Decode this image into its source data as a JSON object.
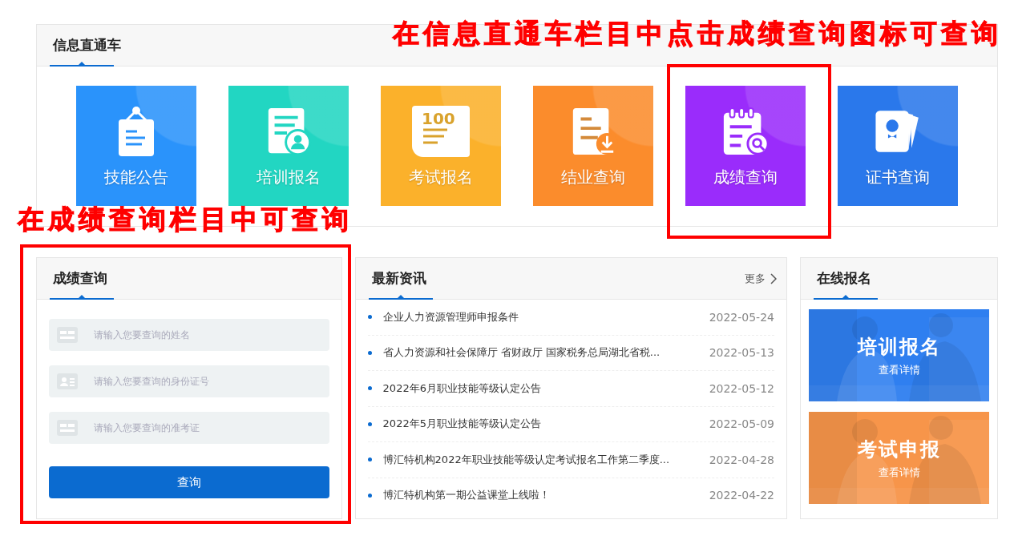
{
  "info_panel": {
    "title": "信息直通车",
    "tiles": [
      {
        "kind": "notice",
        "label": "技能公告",
        "color": "#2a93fb"
      },
      {
        "kind": "signup",
        "label": "培训报名",
        "color": "#22d6c2"
      },
      {
        "kind": "exam",
        "label": "考试报名",
        "icon_text": "100",
        "color": "#fbb12b"
      },
      {
        "kind": "completion",
        "label": "结业查询",
        "color": "#fb8c2c"
      },
      {
        "kind": "score",
        "label": "成绩查询",
        "color": "#9a2cfb"
      },
      {
        "kind": "certificate",
        "label": "证书查询",
        "color": "#2a78eb"
      }
    ]
  },
  "score_panel": {
    "title": "成绩查询",
    "fields": [
      {
        "kind": "card",
        "placeholder": "请输入您要查询的姓名"
      },
      {
        "kind": "id",
        "placeholder": "请输入您要查询的身份证号"
      },
      {
        "kind": "card",
        "placeholder": "请输入您要查询的准考证"
      }
    ],
    "button": "查询"
  },
  "news_panel": {
    "title": "最新资讯",
    "more": "更多",
    "items": [
      {
        "title": "企业人力资源管理师申报条件",
        "date": "2022-05-24"
      },
      {
        "title": "省人力资源和社会保障厅 省财政厅 国家税务总局湖北省税...",
        "date": "2022-05-13"
      },
      {
        "title": "2022年6月职业技能等级认定公告",
        "date": "2022-05-12"
      },
      {
        "title": "2022年5月职业技能等级认定公告",
        "date": "2022-05-09"
      },
      {
        "title": "博汇特机构2022年职业技能等级认定考试报名工作第二季度...",
        "date": "2022-04-28"
      },
      {
        "title": "博汇特机构第一期公益课堂上线啦！",
        "date": "2022-04-22"
      }
    ]
  },
  "signup_panel": {
    "title": "在线报名",
    "cards": [
      {
        "title": "培训报名",
        "link": "查看详情",
        "color": "#2f7ff0"
      },
      {
        "title": "考试申报",
        "link": "查看详情",
        "color": "#f7954a"
      }
    ]
  },
  "annotations": [
    {
      "kind": "top",
      "text": "在信息直通车栏目中点击成绩查询图标可查询"
    },
    {
      "kind": "left",
      "text": "在成绩查询栏目中可查询"
    }
  ]
}
